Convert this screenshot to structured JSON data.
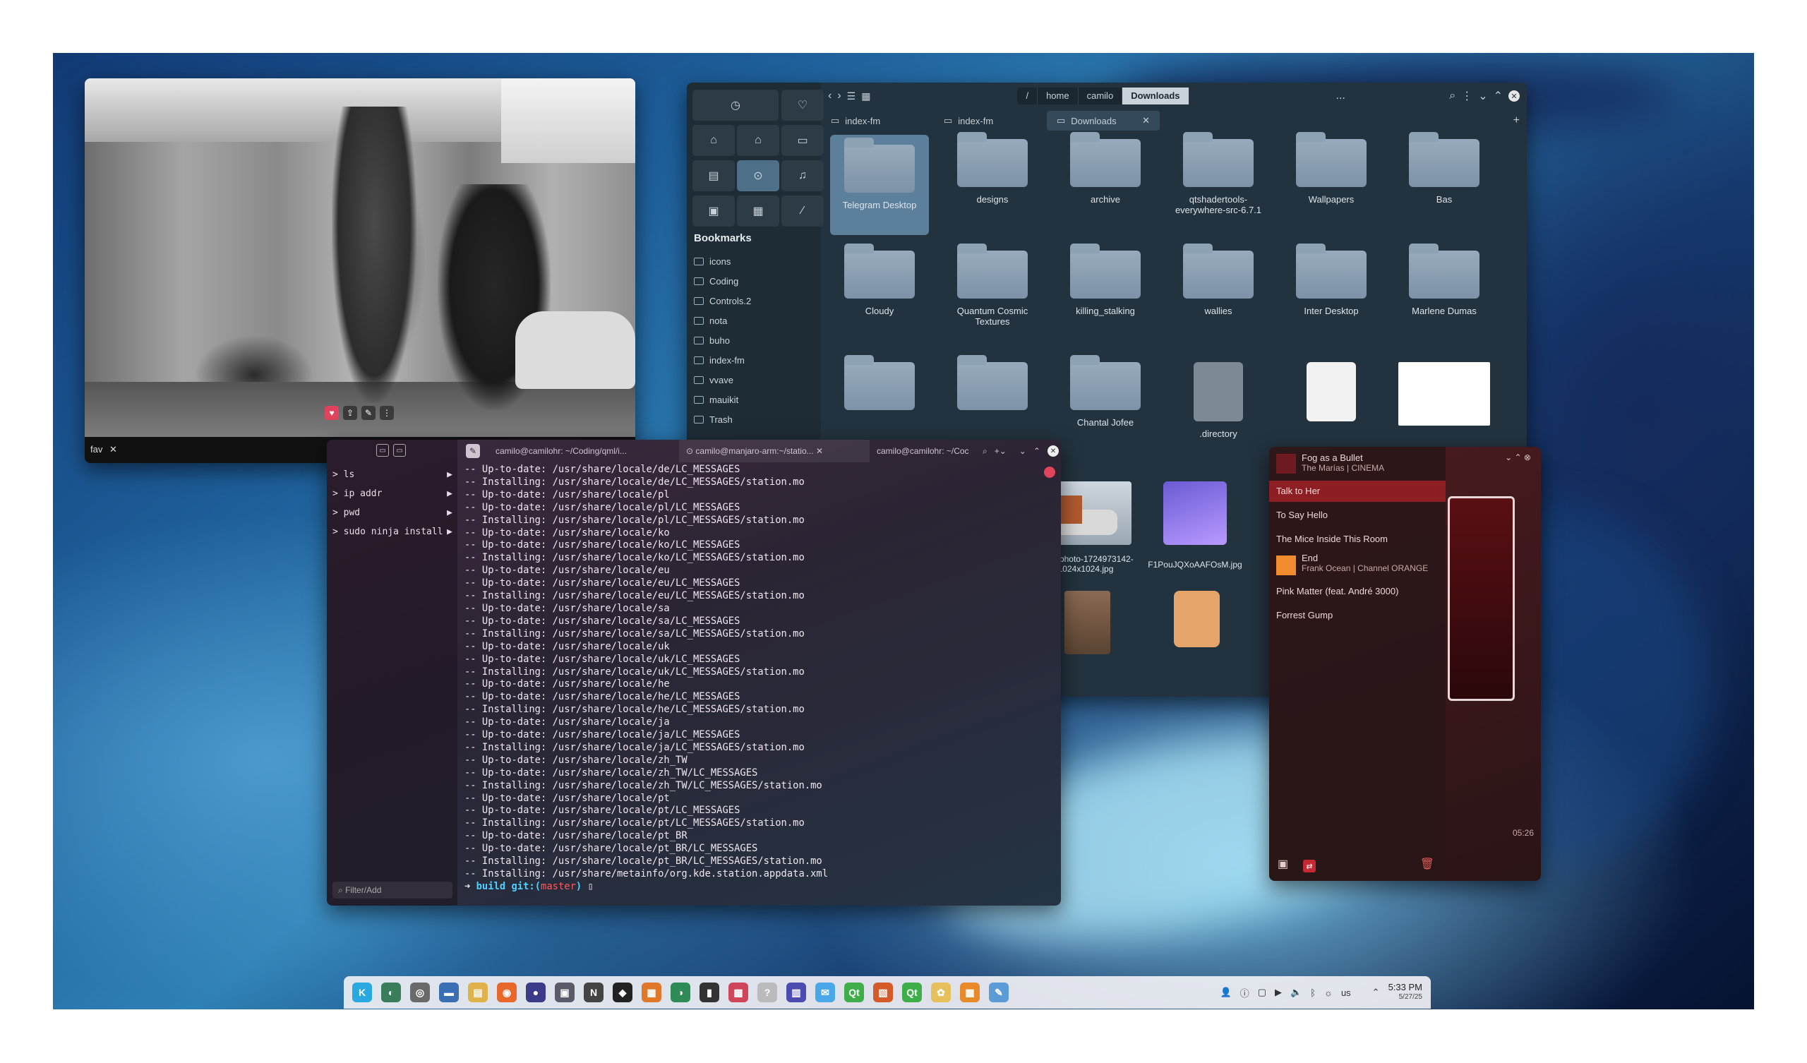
{
  "photo_viewer": {
    "caption": "fav",
    "close": "✕"
  },
  "file_manager": {
    "breadcrumb": [
      "/",
      "home",
      "camilo",
      "Downloads"
    ],
    "ellipsis": "...",
    "tabs": [
      {
        "label": "index-fm"
      },
      {
        "label": "index-fm"
      },
      {
        "label": "Downloads"
      }
    ],
    "bookmarks_title": "Bookmarks",
    "bookmarks": [
      "icons",
      "Coding",
      "Controls.2",
      "nota",
      "buho",
      "index-fm",
      "vvave",
      "mauikit",
      "Trash"
    ],
    "items": [
      "Telegram Desktop",
      "designs",
      "archive",
      "qtshadertools-everywhere-src-6.7.1",
      "Wallpapers",
      "Bas",
      "Cloudy",
      "Quantum Cosmic Textures",
      "killing_stalking",
      "wallies",
      "Inter Desktop",
      "Marlene Dumas",
      "",
      "",
      "Chantal Jofee",
      ".directory",
      "",
      ""
    ],
    "files_row4": [
      "istockphoto-1724973142-1024x1024.jpg",
      "F1PouJQXoAAFOsM.jpg"
    ]
  },
  "terminal": {
    "history": [
      "> ls",
      "> ip addr",
      "> pwd",
      "> sudo ninja install"
    ],
    "filter_placeholder": "Filter/Add",
    "tabs": [
      "camilo@camilohr: ~/Coding/qml/i...",
      "camilo@manjaro-arm:~/statio...",
      "camilo@camilohr: ~/Coc"
    ],
    "output": "-- Up-to-date: /usr/share/locale/de/LC_MESSAGES\n-- Installing: /usr/share/locale/de/LC_MESSAGES/station.mo\n-- Up-to-date: /usr/share/locale/pl\n-- Up-to-date: /usr/share/locale/pl/LC_MESSAGES\n-- Installing: /usr/share/locale/pl/LC_MESSAGES/station.mo\n-- Up-to-date: /usr/share/locale/ko\n-- Up-to-date: /usr/share/locale/ko/LC_MESSAGES\n-- Installing: /usr/share/locale/ko/LC_MESSAGES/station.mo\n-- Up-to-date: /usr/share/locale/eu\n-- Up-to-date: /usr/share/locale/eu/LC_MESSAGES\n-- Installing: /usr/share/locale/eu/LC_MESSAGES/station.mo\n-- Up-to-date: /usr/share/locale/sa\n-- Up-to-date: /usr/share/locale/sa/LC_MESSAGES\n-- Installing: /usr/share/locale/sa/LC_MESSAGES/station.mo\n-- Up-to-date: /usr/share/locale/uk\n-- Up-to-date: /usr/share/locale/uk/LC_MESSAGES\n-- Installing: /usr/share/locale/uk/LC_MESSAGES/station.mo\n-- Up-to-date: /usr/share/locale/he\n-- Up-to-date: /usr/share/locale/he/LC_MESSAGES\n-- Installing: /usr/share/locale/he/LC_MESSAGES/station.mo\n-- Up-to-date: /usr/share/locale/ja\n-- Up-to-date: /usr/share/locale/ja/LC_MESSAGES\n-- Installing: /usr/share/locale/ja/LC_MESSAGES/station.mo\n-- Up-to-date: /usr/share/locale/zh_TW\n-- Up-to-date: /usr/share/locale/zh_TW/LC_MESSAGES\n-- Installing: /usr/share/locale/zh_TW/LC_MESSAGES/station.mo\n-- Up-to-date: /usr/share/locale/pt\n-- Up-to-date: /usr/share/locale/pt/LC_MESSAGES\n-- Installing: /usr/share/locale/pt/LC_MESSAGES/station.mo\n-- Up-to-date: /usr/share/locale/pt_BR\n-- Up-to-date: /usr/share/locale/pt_BR/LC_MESSAGES\n-- Installing: /usr/share/locale/pt_BR/LC_MESSAGES/station.mo\n-- Installing: /usr/share/metainfo/org.kde.station.appdata.xml",
    "prompt_dir": "build",
    "prompt_git": "git:(",
    "prompt_branch": "master",
    "prompt_close": ")"
  },
  "music": {
    "now_title": "Fog as a Bullet",
    "now_sub": "The Marías | CINEMA",
    "tracks": [
      {
        "title": "Talk to Her"
      },
      {
        "title": "To Say Hello"
      },
      {
        "title": "The Mice Inside This Room"
      },
      {
        "title": "End",
        "sub": "Frank Ocean | Channel ORANGE"
      },
      {
        "title": "Pink Matter (feat. André 3000)"
      },
      {
        "title": "Forrest Gump"
      }
    ],
    "time": "05:26"
  },
  "dock": {
    "apps": [
      "K",
      "◐",
      "◎",
      "▬",
      "▤",
      "◉",
      "●",
      "▣",
      "N",
      "◆",
      "▦",
      "◑",
      "▮",
      "▩",
      "?",
      "▥",
      "✉",
      "Qt",
      "▧",
      "Qt",
      "✿",
      "▦",
      "✎"
    ],
    "tray_lang": "us",
    "time": "5:33 PM",
    "date": "5/27/25"
  }
}
